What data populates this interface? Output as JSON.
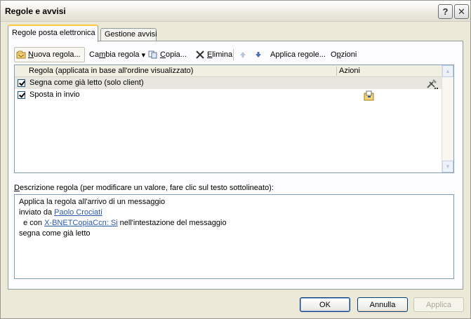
{
  "window": {
    "title": "Regole e avvisi",
    "help_label": "?",
    "close_label": "✕"
  },
  "tabs": [
    {
      "label": "Regole posta elettronica",
      "active": true
    },
    {
      "label": "Gestione avvisi",
      "active": false
    }
  ],
  "toolbar": {
    "new_rule": {
      "label_underlined": "N",
      "label_rest": "uova regola...",
      "icon": "new-rule-icon"
    },
    "change_rule": {
      "label_before": "Ca",
      "label_underlined": "m",
      "label_after": "bia regola",
      "arrow": "▾"
    },
    "copy": {
      "label_underlined": "C",
      "label_rest": "opia...",
      "icon": "copy-icon"
    },
    "delete": {
      "label_underlined": "E",
      "label_rest": "limina",
      "icon": "delete-icon"
    },
    "move_up_icon": "arrow-up-icon",
    "move_down_icon": "arrow-down-icon",
    "apply_rules": {
      "label_before": "Applica re",
      "label_underlined": "g",
      "label_after": "ole..."
    },
    "options": {
      "label_before": "O",
      "label_underlined": "p",
      "label_after": "zioni"
    }
  },
  "rule_list": {
    "columns": [
      "Regola (applicata in base all'ordine visualizzato)",
      "Azioni"
    ],
    "rows": [
      {
        "checked": true,
        "name": "Segna come già letto  (solo client)",
        "action_icon": "tools-icon",
        "selected": true
      },
      {
        "checked": true,
        "name": "Sposta in invio",
        "action_icon": "move-to-folder-icon",
        "selected": false
      }
    ]
  },
  "description": {
    "label_underlined": "D",
    "label_rest": "escrizione regola (per modificare un valore, fare clic sul testo sottolineato):",
    "line1": "Applica la regola all'arrivo di un messaggio",
    "line2_text": "inviato da ",
    "line2_link": "Paolo Crociati",
    "line3_prefix": "  e con ",
    "line3_link": "X-BNETCopiaCcn: Si",
    "line3_suffix": " nell'intestazione del messaggio",
    "line4": "segna come già letto"
  },
  "buttons": {
    "ok": "OK",
    "cancel": "Annulla",
    "apply": "Applica"
  }
}
